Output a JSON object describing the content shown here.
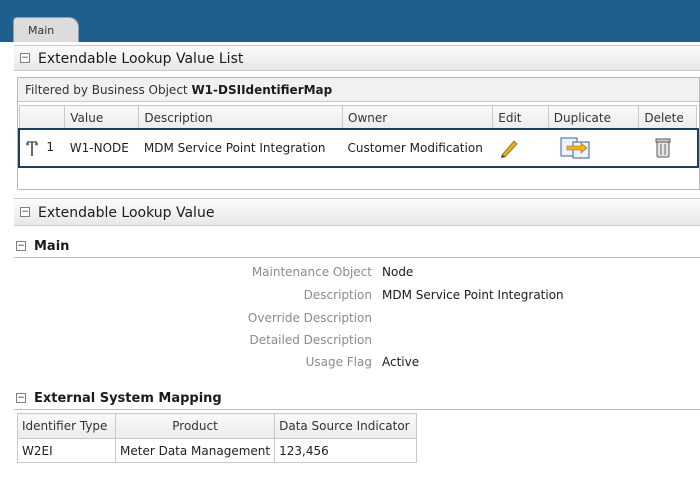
{
  "tabs": [
    {
      "label": "Main"
    }
  ],
  "lookup_list": {
    "title": "Extendable Lookup Value List",
    "filter_prefix": "Filtered by Business Object ",
    "filter_value": "W1-DSIIdentifierMap",
    "columns": [
      "Value",
      "Description",
      "Owner",
      "Edit",
      "Duplicate",
      "Delete"
    ],
    "rows": [
      {
        "index": "1",
        "value": "W1-NODE",
        "description": "MDM Service Point Integration",
        "owner": "Customer Modification"
      }
    ]
  },
  "detail": {
    "title": "Extendable Lookup Value",
    "main_title": "Main",
    "fields": [
      {
        "label": "Maintenance Object",
        "value": "Node"
      },
      {
        "label": "Description",
        "value": "MDM Service Point Integration"
      },
      {
        "label": "Override Description",
        "value": ""
      },
      {
        "label": "Detailed Description",
        "value": ""
      },
      {
        "label": "Usage Flag",
        "value": "Active"
      }
    ],
    "mapping_title": "External System Mapping",
    "mapping_columns": [
      "Identifier Type",
      "Product",
      "Data Source Indicator"
    ],
    "mapping_rows": [
      {
        "identifier_type": "W2EI",
        "product": "Meter Data Management",
        "data_source_indicator": "123,456"
      }
    ]
  },
  "colors": {
    "top_bar": "#1f5f8f",
    "selected_row_outline": "#1f3f5f",
    "label_gray": "#8b8b8b"
  },
  "icons": [
    "tree-icon",
    "edit-pencil-icon",
    "duplicate-icon",
    "delete-trash-icon",
    "collapse-icon"
  ]
}
